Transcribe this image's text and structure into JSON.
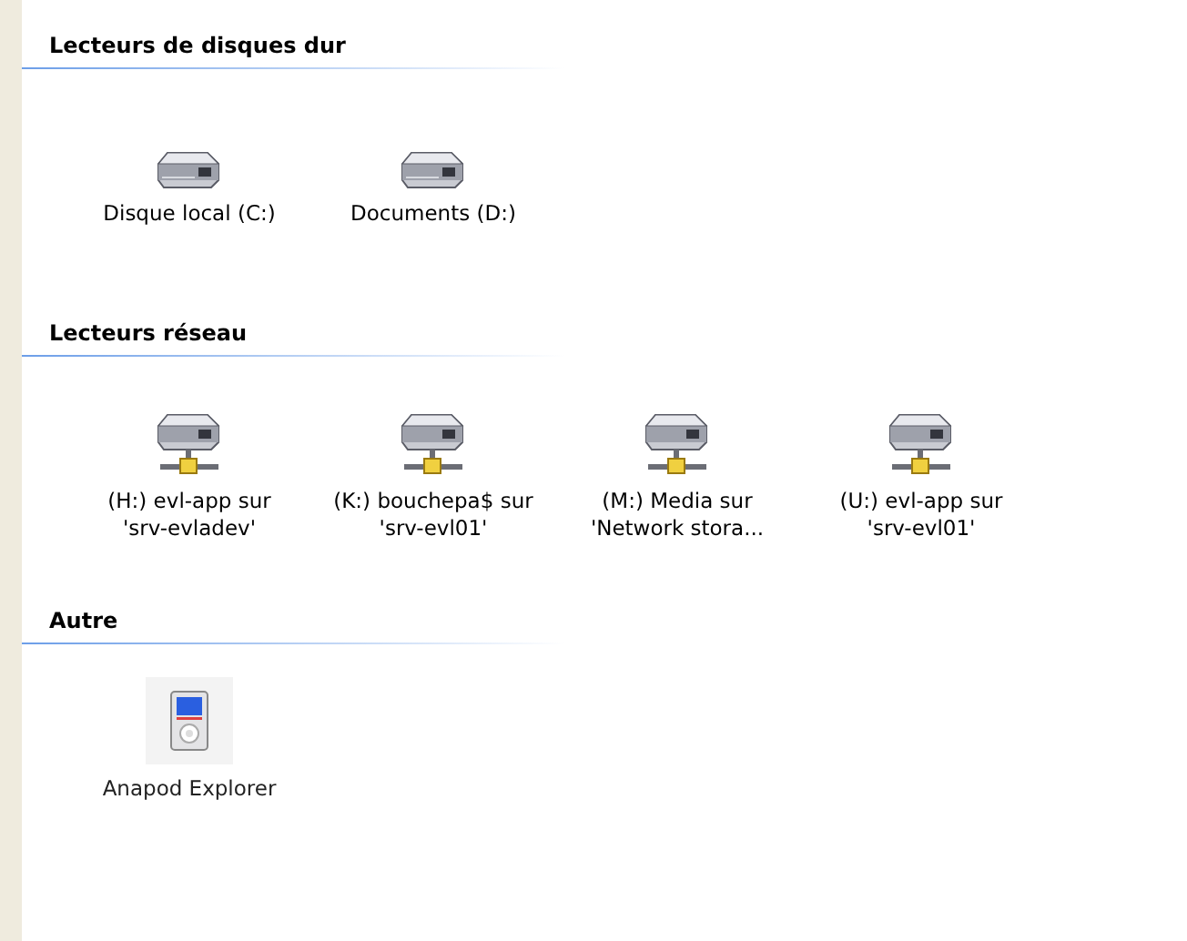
{
  "sections": [
    {
      "title": "Lecteurs de disques dur",
      "items": [
        {
          "kind": "disk",
          "lines": [
            "Disque local (C:)"
          ]
        },
        {
          "kind": "disk",
          "lines": [
            "Documents (D:)"
          ]
        }
      ]
    },
    {
      "title": "Lecteurs réseau",
      "items": [
        {
          "kind": "network",
          "lines": [
            "(H:) evl-app sur",
            "'srv-evladev'"
          ]
        },
        {
          "kind": "network",
          "lines": [
            "(K:) bouchepa$ sur",
            "'srv-evl01'"
          ]
        },
        {
          "kind": "network",
          "lines": [
            "(M:) Media sur",
            "'Network stora..."
          ]
        },
        {
          "kind": "network",
          "lines": [
            "(U:) evl-app sur",
            "'srv-evl01'"
          ]
        }
      ]
    },
    {
      "title": "Autre",
      "items": [
        {
          "kind": "device",
          "lines": [
            "Anapod Explorer"
          ]
        }
      ]
    }
  ]
}
